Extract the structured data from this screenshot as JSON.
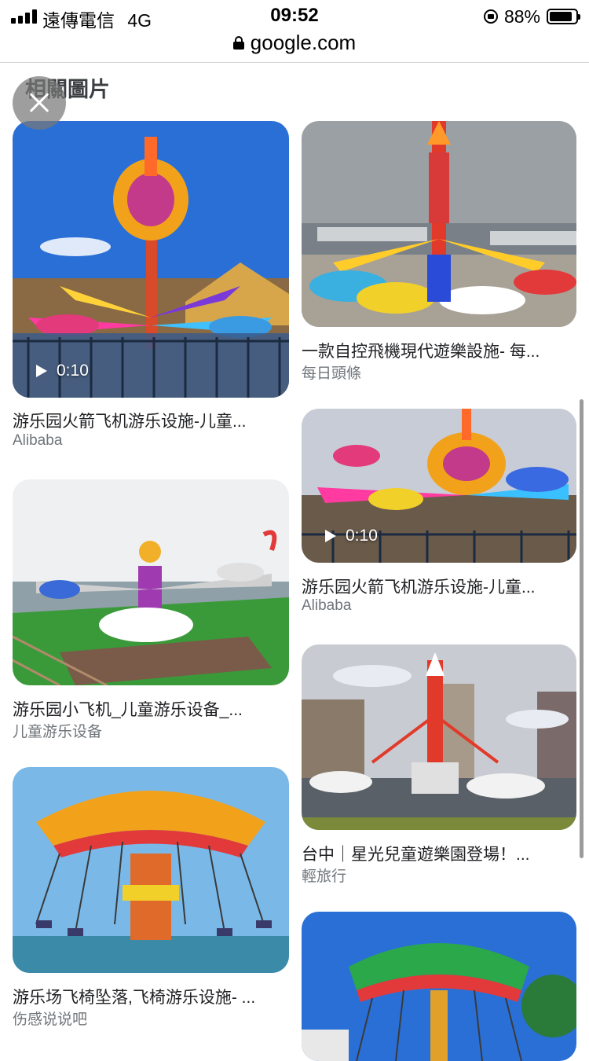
{
  "status_bar": {
    "carrier": "遠傳電信",
    "network": "4G",
    "time": "09:52",
    "battery_percent": "88%",
    "battery_level": 0.88
  },
  "url_bar": {
    "domain": "google.com"
  },
  "section": {
    "title": "相關圖片"
  },
  "results": [
    {
      "title": "游乐园火箭飞机游乐设施-儿童...",
      "source": "Alibaba",
      "video_duration": "0:10"
    },
    {
      "title": "一款自控飛機現代遊樂設施- 每...",
      "source": "每日頭條"
    },
    {
      "title": "游乐园小飞机_儿童游乐设备_...",
      "source": "儿童游乐设备"
    },
    {
      "title": "游乐园火箭飞机游乐设施-儿童...",
      "source": "Alibaba",
      "video_duration": "0:10"
    },
    {
      "title": "游乐场飞椅坠落,飞椅游乐设施- ...",
      "source": "伤感说说吧"
    },
    {
      "title": "台中｜星光兒童遊樂園登場！...",
      "source": "輕旅行"
    }
  ],
  "colors": {
    "sky_blue": "#2a6fd6",
    "source_gray": "#70757a"
  }
}
